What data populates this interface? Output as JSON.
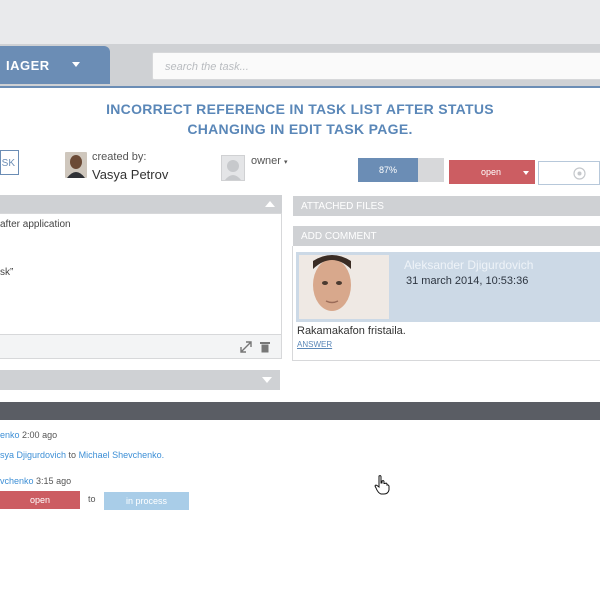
{
  "header": {
    "brand_text": "IAGER",
    "search_placeholder": "search the task..."
  },
  "task": {
    "title_line1": "INCORRECT REFERENCE IN  TASK LIST AFTER STATUS",
    "title_line2": "CHANGING IN EDIT TASK PAGE.",
    "task_button_label": "SK",
    "created_by_label": "created by:",
    "creator_name": "Vasya Petrov",
    "owner_label": "owner",
    "progress_percent": 87,
    "progress_label": "87%",
    "status_label": "open"
  },
  "description": {
    "line1": "after application",
    "line2": "sk”"
  },
  "sections": {
    "attached_files": "ATTACHED FILES",
    "add_comment": "ADD COMMENT"
  },
  "comment": {
    "author": "Aleksander Djigurdovich",
    "date": "31 march 2014, 10:53:36",
    "text": "Rakamakafon fristaila.",
    "answer_label": "ANSWER"
  },
  "history": {
    "entry1_user": "enko",
    "entry1_time": "2:00 ago",
    "entry1_from": "sya Djigurdovich",
    "entry1_to_word": "to",
    "entry1_to": "Michael Shevchenko.",
    "entry2_user": "vchenko",
    "entry2_time": "3:15 ago",
    "entry2_from_status": "open",
    "entry2_to_word": "to",
    "entry2_to_status": "in process"
  },
  "colors": {
    "accent": "#6b8db5",
    "open_status": "#cc5d62",
    "in_process_status": "#a9cde8",
    "link": "#3d8fd6"
  }
}
